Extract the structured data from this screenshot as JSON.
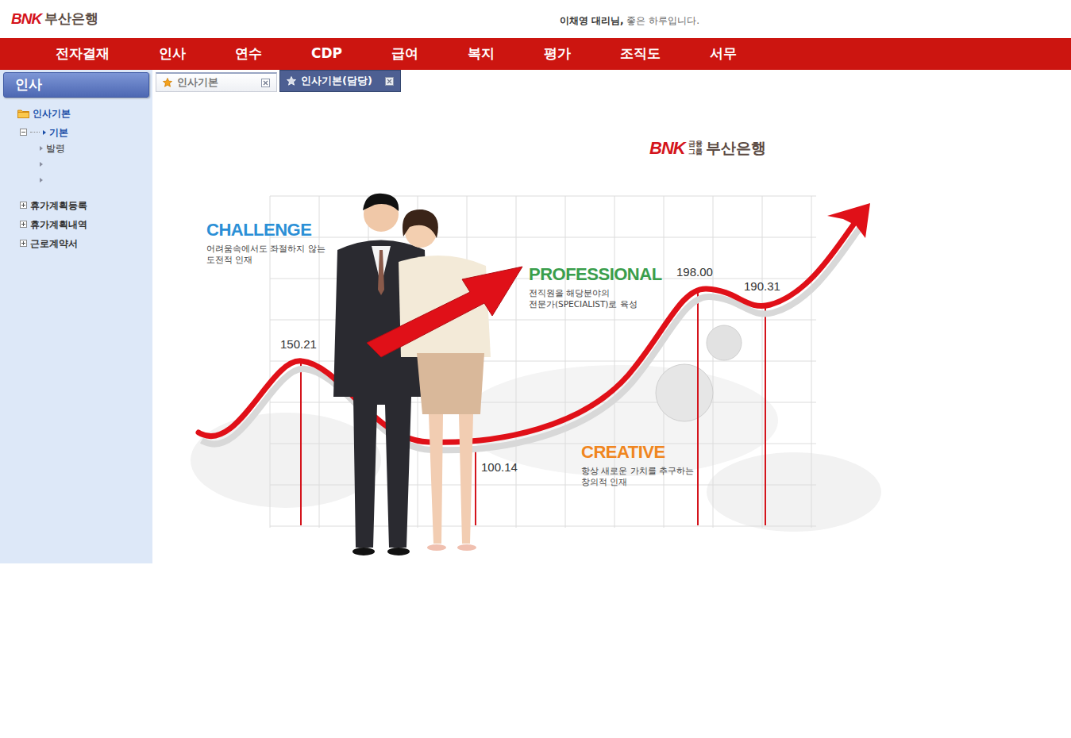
{
  "header": {
    "logo": {
      "mark": "BNK",
      "name": "부산은행"
    },
    "greeting": {
      "user": "이채영 대리님,",
      "message": "좋은 하루입니다."
    }
  },
  "menu": [
    "전자결재",
    "인사",
    "연수",
    "CDP",
    "급여",
    "복지",
    "평가",
    "조직도",
    "서무"
  ],
  "sidebar": {
    "title": "인사",
    "tree": [
      {
        "label": "인사기본",
        "kind": "folder",
        "expanded": true,
        "children": [
          {
            "label": "기본",
            "selected": true
          },
          {
            "label": "발령",
            "selected": false
          },
          {
            "label": "",
            "selected": false
          },
          {
            "label": "",
            "selected": false
          }
        ]
      },
      {
        "label": "휴가계획등록",
        "kind": "group",
        "expanded": false,
        "children": []
      },
      {
        "label": "휴가계획내역",
        "kind": "group",
        "expanded": false,
        "children": []
      },
      {
        "label": "근로계약서",
        "kind": "group",
        "expanded": false,
        "children": []
      }
    ]
  },
  "tabs": [
    {
      "label": "인사기본",
      "selected": false
    },
    {
      "label": "인사기본(담당)",
      "selected": true
    }
  ],
  "banner": {
    "brand": {
      "mark": "BNK",
      "group": [
        "금융",
        "그룹"
      ],
      "name": "부산은행"
    },
    "values": [
      {
        "title": "CHALLENGE",
        "lines": [
          "어려움속에서도 좌절하지 않는",
          "도전적 인재"
        ],
        "color": "#2b8fd6"
      },
      {
        "title": "PROFESSIONAL",
        "lines": [
          "전직원을 해당분야의",
          "전문가(SPECIALIST)로 육성"
        ],
        "color": "#3a9e4c"
      },
      {
        "title": "CREATIVE",
        "lines": [
          "항상 새로운 가치를 추구하는",
          "창의적 인재"
        ],
        "color": "#f0861e"
      }
    ],
    "points": [
      "150.21",
      "100.14",
      "198.00",
      "190.31"
    ]
  }
}
